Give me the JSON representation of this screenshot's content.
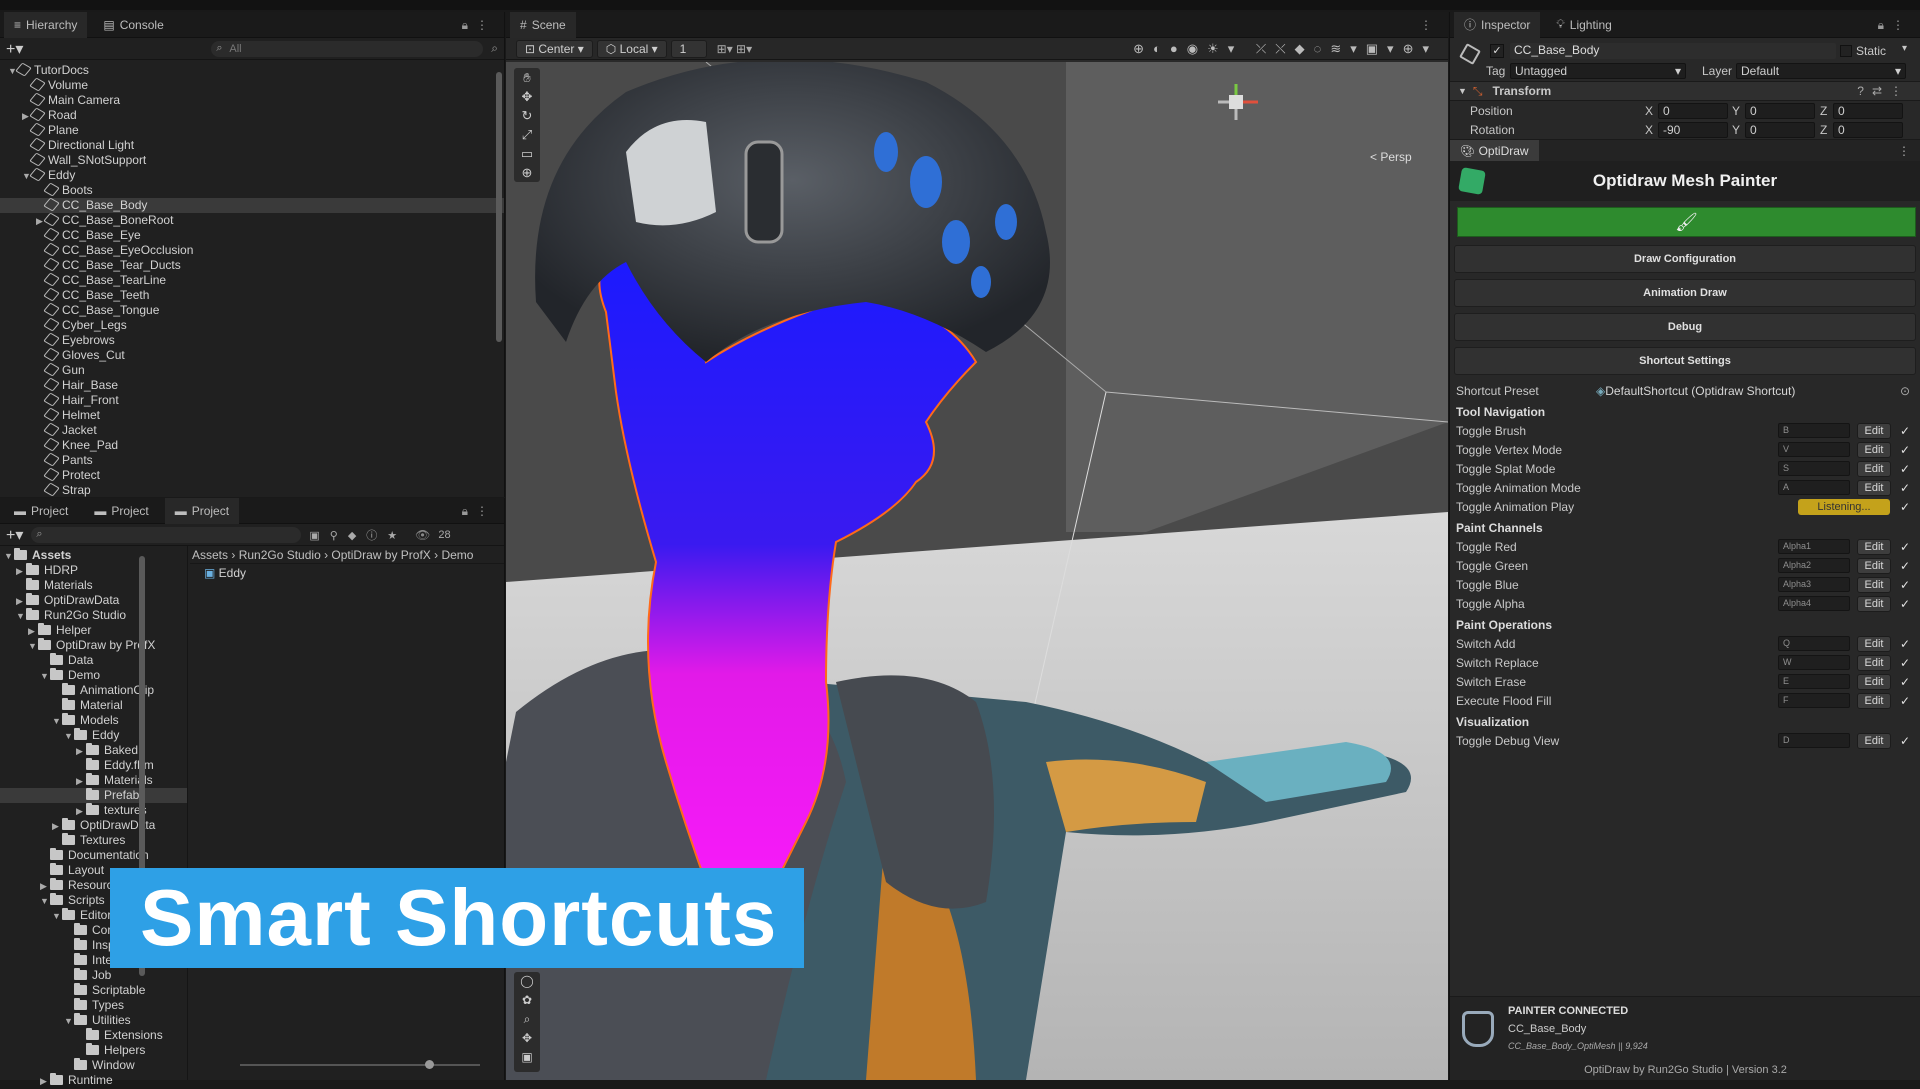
{
  "hierarchy": {
    "tabs": [
      "Hierarchy",
      "Console"
    ],
    "search_placeholder": "All",
    "items": [
      {
        "label": "TutorDocs",
        "indent": 0,
        "expanded": true,
        "kind": "scene"
      },
      {
        "label": "Volume",
        "indent": 1
      },
      {
        "label": "Main Camera",
        "indent": 1
      },
      {
        "label": "Road",
        "indent": 1,
        "collapsed": true
      },
      {
        "label": "Plane",
        "indent": 1
      },
      {
        "label": "Directional Light",
        "indent": 1
      },
      {
        "label": "Wall_SNotSupport",
        "indent": 1
      },
      {
        "label": "Eddy",
        "indent": 1,
        "expanded": true
      },
      {
        "label": "Boots",
        "indent": 2
      },
      {
        "label": "CC_Base_Body",
        "indent": 2,
        "selected": true
      },
      {
        "label": "CC_Base_BoneRoot",
        "indent": 2,
        "collapsed": true
      },
      {
        "label": "CC_Base_Eye",
        "indent": 2
      },
      {
        "label": "CC_Base_EyeOcclusion",
        "indent": 2
      },
      {
        "label": "CC_Base_Tear_Ducts",
        "indent": 2
      },
      {
        "label": "CC_Base_TearLine",
        "indent": 2
      },
      {
        "label": "CC_Base_Teeth",
        "indent": 2
      },
      {
        "label": "CC_Base_Tongue",
        "indent": 2
      },
      {
        "label": "Cyber_Legs",
        "indent": 2
      },
      {
        "label": "Eyebrows",
        "indent": 2
      },
      {
        "label": "Gloves_Cut",
        "indent": 2
      },
      {
        "label": "Gun",
        "indent": 2
      },
      {
        "label": "Hair_Base",
        "indent": 2
      },
      {
        "label": "Hair_Front",
        "indent": 2
      },
      {
        "label": "Helmet",
        "indent": 2
      },
      {
        "label": "Jacket",
        "indent": 2
      },
      {
        "label": "Knee_Pad",
        "indent": 2
      },
      {
        "label": "Pants",
        "indent": 2
      },
      {
        "label": "Protect",
        "indent": 2
      },
      {
        "label": "Strap",
        "indent": 2
      }
    ]
  },
  "project": {
    "tabs": [
      "Project",
      "Project",
      "Project"
    ],
    "count": "28",
    "breadcrumb": [
      "Assets",
      "Run2Go Studio",
      "OptiDraw by ProfX",
      "Demo"
    ],
    "content_items": [
      "Eddy"
    ],
    "tree": [
      {
        "label": "Assets",
        "indent": 0,
        "expanded": true,
        "bold": true
      },
      {
        "label": "HDRP",
        "indent": 1,
        "collapsed": true
      },
      {
        "label": "Materials",
        "indent": 1
      },
      {
        "label": "OptiDrawData",
        "indent": 1,
        "collapsed": true
      },
      {
        "label": "Run2Go Studio",
        "indent": 1,
        "expanded": true
      },
      {
        "label": "Helper",
        "indent": 2,
        "collapsed": true
      },
      {
        "label": "OptiDraw by ProfX",
        "indent": 2,
        "expanded": true
      },
      {
        "label": "Data",
        "indent": 3
      },
      {
        "label": "Demo",
        "indent": 3,
        "expanded": true
      },
      {
        "label": "AnimationClip",
        "indent": 4
      },
      {
        "label": "Material",
        "indent": 4
      },
      {
        "label": "Models",
        "indent": 4,
        "expanded": true
      },
      {
        "label": "Eddy",
        "indent": 5,
        "expanded": true
      },
      {
        "label": "Baked",
        "indent": 6,
        "collapsed": true
      },
      {
        "label": "Eddy.fbm",
        "indent": 6
      },
      {
        "label": "Materials",
        "indent": 6,
        "collapsed": true
      },
      {
        "label": "Prefabs",
        "indent": 6,
        "selected": true
      },
      {
        "label": "textures",
        "indent": 6,
        "collapsed": true
      },
      {
        "label": "OptiDrawData",
        "indent": 4,
        "collapsed": true
      },
      {
        "label": "Textures",
        "indent": 4
      },
      {
        "label": "Documentation",
        "indent": 3
      },
      {
        "label": "Layout",
        "indent": 3
      },
      {
        "label": "Resources",
        "indent": 3,
        "collapsed": true
      },
      {
        "label": "Scripts",
        "indent": 3,
        "expanded": true
      },
      {
        "label": "Editor",
        "indent": 4,
        "expanded": true
      },
      {
        "label": "Core",
        "indent": 5
      },
      {
        "label": "Inspector",
        "indent": 5
      },
      {
        "label": "Interface",
        "indent": 5
      },
      {
        "label": "Job",
        "indent": 5
      },
      {
        "label": "Scriptable",
        "indent": 5
      },
      {
        "label": "Types",
        "indent": 5
      },
      {
        "label": "Utilities",
        "indent": 5,
        "expanded": true
      },
      {
        "label": "Extensions",
        "indent": 6
      },
      {
        "label": "Helpers",
        "indent": 6
      },
      {
        "label": "Window",
        "indent": 5
      },
      {
        "label": "Runtime",
        "indent": 3,
        "collapsed": true
      }
    ]
  },
  "scene": {
    "tab": "Scene",
    "pivot": "Center",
    "space": "Local",
    "grid_value": "1",
    "projection": "< Persp",
    "gizmo_axes": {
      "y": "y",
      "x": "x"
    }
  },
  "overlay": {
    "title": "Smart Shortcuts"
  },
  "inspector": {
    "tabs": [
      "Inspector",
      "Lighting"
    ],
    "object_name": "CC_Base_Body",
    "static_label": "Static",
    "tag_label": "Tag",
    "tag_value": "Untagged",
    "layer_label": "Layer",
    "layer_value": "Default",
    "transform": {
      "title": "Transform",
      "position_label": "Position",
      "rotation_label": "Rotation",
      "position": {
        "x": "0",
        "y": "0",
        "z": "0"
      },
      "rotation": {
        "x": "-90",
        "y": "0",
        "z": "0"
      }
    },
    "component_tab": "OptiDraw",
    "painter_title": "Optidraw Mesh Painter",
    "foldouts": [
      "Draw Configuration",
      "Animation Draw",
      "Debug",
      "Shortcut Settings"
    ],
    "shortcut_preset_label": "Shortcut Preset",
    "shortcut_preset_value": "DefaultShortcut (Optidraw Shortcut)",
    "edit_label": "Edit",
    "groups": [
      {
        "title": "Tool Navigation",
        "rows": [
          {
            "label": "Toggle Brush",
            "key": "B"
          },
          {
            "label": "Toggle Vertex Mode",
            "key": "V"
          },
          {
            "label": "Toggle Splat Mode",
            "key": "S"
          },
          {
            "label": "Toggle Animation Mode",
            "key": "A"
          },
          {
            "label": "Toggle Animation Play",
            "key": "",
            "listening": "Listening..."
          }
        ]
      },
      {
        "title": "Paint Channels",
        "rows": [
          {
            "label": "Toggle Red",
            "key": "Alpha1"
          },
          {
            "label": "Toggle Green",
            "key": "Alpha2"
          },
          {
            "label": "Toggle Blue",
            "key": "Alpha3"
          },
          {
            "label": "Toggle Alpha",
            "key": "Alpha4"
          }
        ]
      },
      {
        "title": "Paint Operations",
        "rows": [
          {
            "label": "Switch Add",
            "key": "Q"
          },
          {
            "label": "Switch Replace",
            "key": "W"
          },
          {
            "label": "Switch Erase",
            "key": "E"
          },
          {
            "label": "Execute Flood Fill",
            "key": "F"
          }
        ]
      },
      {
        "title": "Visualization",
        "rows": [
          {
            "label": "Toggle Debug View",
            "key": "D"
          }
        ]
      }
    ],
    "status": {
      "title": "PAINTER CONNECTED",
      "object": "CC_Base_Body",
      "mesh_info": "CC_Base_Body_OptiMesh || 9,924",
      "footer": "OptiDraw by Run2Go Studio | Version 3.2"
    }
  },
  "colors": {
    "accent_green": "#2e8b2e",
    "listening_yellow": "#c4a21b",
    "overlay_blue": "#2ea0e6",
    "paint_blue": "#1a1aff",
    "paint_magenta": "#ff1aff"
  }
}
